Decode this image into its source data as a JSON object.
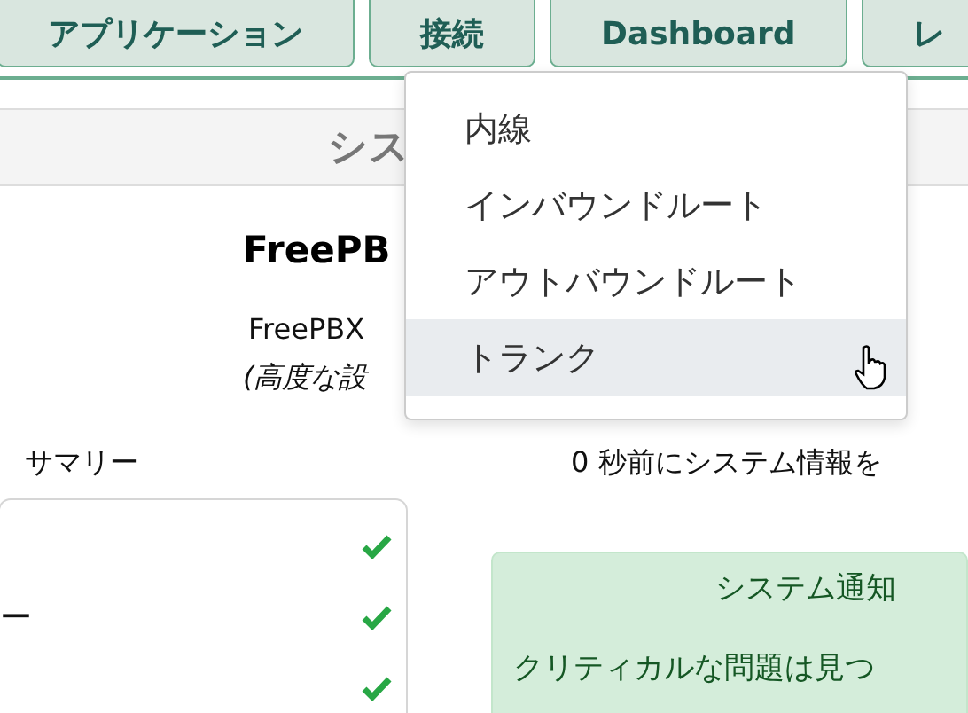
{
  "nav_tabs": [
    {
      "label": "アプリケーション"
    },
    {
      "label": "接続"
    },
    {
      "label": "Dashboard"
    },
    {
      "label": "レ"
    }
  ],
  "dropdown": {
    "items": [
      {
        "label": "内線",
        "hovered": false
      },
      {
        "label": "インバウンドルート",
        "hovered": false
      },
      {
        "label": "アウトバウンドルート",
        "hovered": false
      },
      {
        "label": "トランク",
        "hovered": true
      }
    ]
  },
  "header": {
    "title": "シス"
  },
  "info": {
    "title": "FreePB",
    "version": "FreePBX",
    "note": "(高度な設"
  },
  "summary": {
    "label": "サマリー",
    "refresh": "0 秒前にシステム情報を"
  },
  "status_rows": [
    {
      "ok": true
    },
    {
      "label": "ー",
      "ok": true
    },
    {
      "ok": true
    }
  ],
  "notice": {
    "title": "システム通知",
    "message": "クリティカルな問題は見つ"
  }
}
